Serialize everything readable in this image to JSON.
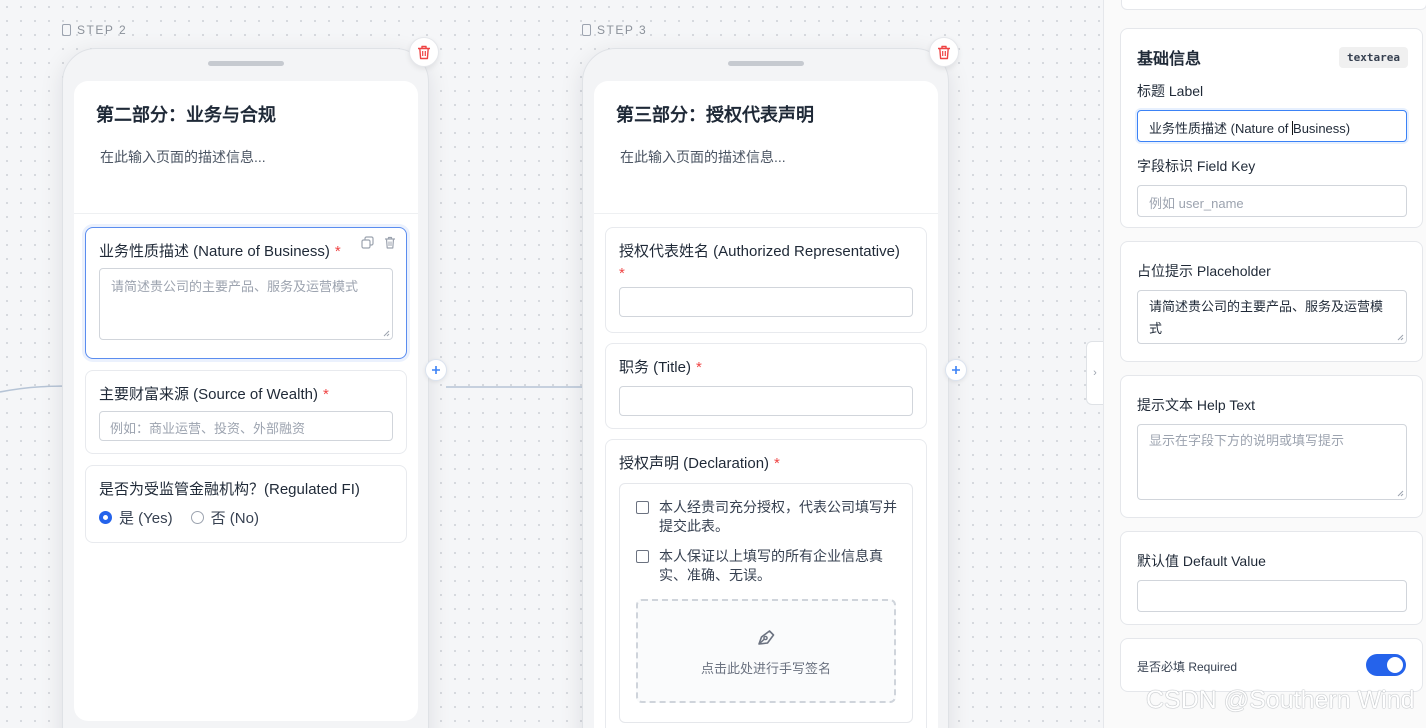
{
  "steps": [
    {
      "label": "STEP 2",
      "title": "第二部分：业务与合规",
      "description": "在此输入页面的描述信息...",
      "fields": {
        "nature": {
          "label": "业务性质描述 (Nature of Business)",
          "required": "*",
          "placeholder": "请简述贵公司的主要产品、服务及运营模式"
        },
        "wealth": {
          "label": "主要财富来源 (Source of Wealth)",
          "required": "*",
          "placeholder": "例如：商业运营、投资、外部融资"
        },
        "regulated": {
          "label": "是否为受监管金融机构？(Regulated FI)",
          "options": [
            "是 (Yes)",
            "否 (No)"
          ],
          "selected": "是 (Yes)"
        }
      }
    },
    {
      "label": "STEP 3",
      "title": "第三部分：授权代表声明",
      "description": "在此输入页面的描述信息...",
      "fields": {
        "rep_name": {
          "label": "授权代表姓名 (Authorized Representative)",
          "required": "*"
        },
        "rep_title": {
          "label": "职务 (Title)",
          "required": "*"
        },
        "declaration": {
          "label": "授权声明 (Declaration)",
          "required": "*",
          "checks": [
            "本人经贵司充分授权，代表公司填写并提交此表。",
            "本人保证以上填写的所有企业信息真实、准确、无误。"
          ],
          "signature_hint": "点击此处进行手写签名"
        }
      }
    }
  ],
  "panel": {
    "basic": {
      "title": "基础信息",
      "type_tag": "textarea",
      "label_label": "标题 Label",
      "label_value_before": "业务性质描述 (Nature of ",
      "label_value_after": "Business)",
      "key_label": "字段标识 Field Key",
      "key_placeholder": "例如 user_name"
    },
    "placeholder": {
      "label": "占位提示 Placeholder",
      "value": "请简述贵公司的主要产品、服务及运营模式"
    },
    "help": {
      "label": "提示文本 Help Text",
      "placeholder": "显示在字段下方的说明或填写提示"
    },
    "default": {
      "label": "默认值 Default Value",
      "value": ""
    },
    "required": {
      "label": "是否必填 Required",
      "on": true
    }
  },
  "watermark": "CSDN @Southern Wind",
  "icons": {
    "delete": "trash-icon",
    "copy": "copy-icon",
    "add": "plus-icon",
    "signature": "pen-icon",
    "collapse": "chevron-right-icon",
    "device": "phone-icon"
  },
  "colors": {
    "accent": "#2563eb",
    "danger": "#ef4444",
    "highlight": "#4f46e5"
  }
}
